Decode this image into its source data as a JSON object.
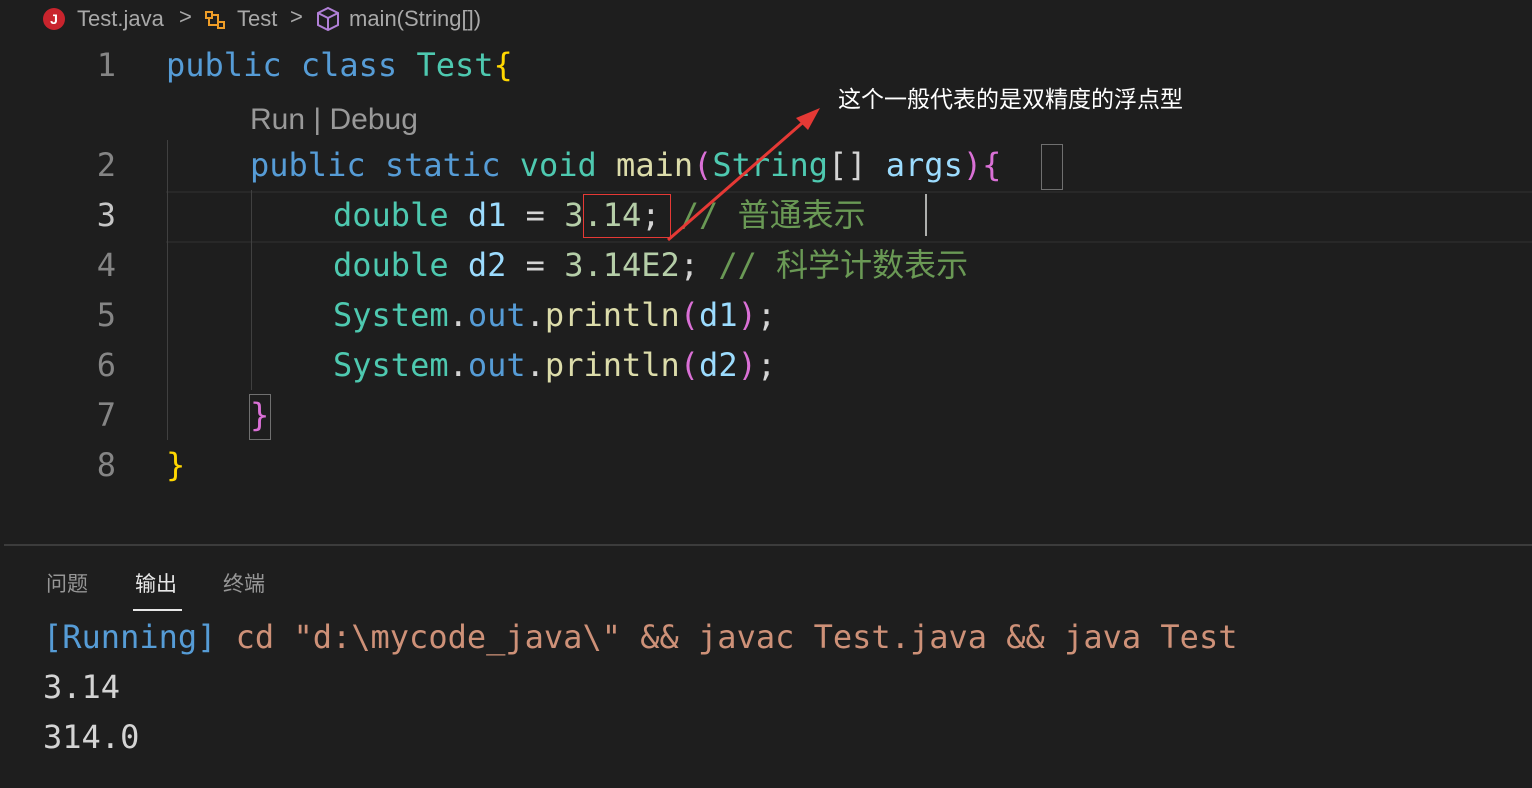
{
  "breadcrumb": {
    "file_icon_letter": "J",
    "file": "Test.java",
    "class": "Test",
    "method": "main(String[])",
    "separator": ">"
  },
  "editor": {
    "line_numbers": [
      "1",
      "2",
      "3",
      "4",
      "5",
      "6",
      "7",
      "8"
    ],
    "codelens": "Run | Debug",
    "lines": {
      "l1": {
        "kw1": "public",
        "kw2": "class",
        "name": "Test",
        "brace": "{"
      },
      "l2": {
        "kw1": "public",
        "kw2": "static",
        "kw3": "void",
        "fn": "main",
        "open": "(",
        "type": "String",
        "arr": "[]",
        "arg": "args",
        "close": ")",
        "brace": "{"
      },
      "l3": {
        "type": "double",
        "var": "d1",
        "eq": "=",
        "num": "3.14",
        "semi": ";",
        "comment": "// 普通表示"
      },
      "l4": {
        "type": "double",
        "var": "d2",
        "eq": "=",
        "num": "3.14E2",
        "semi": ";",
        "comment": "// 科学计数表示"
      },
      "l5": {
        "cls": "System",
        "dot1": ".",
        "field": "out",
        "dot2": ".",
        "fn": "println",
        "open": "(",
        "arg": "d1",
        "close": ")",
        "semi": ";"
      },
      "l6": {
        "cls": "System",
        "dot1": ".",
        "field": "out",
        "dot2": ".",
        "fn": "println",
        "open": "(",
        "arg": "d2",
        "close": ")",
        "semi": ";"
      },
      "l7": {
        "brace": "}"
      },
      "l8": {
        "brace": "}"
      }
    }
  },
  "annotation": {
    "text": "这个一般代表的是双精度的浮点型",
    "arrow_color": "#e53935"
  },
  "panel": {
    "tabs": [
      "问题",
      "输出",
      "终端"
    ],
    "active_tab": "输出",
    "output": {
      "running": "[Running]",
      "command": "cd \"d:\\mycode_java\\\" && javac Test.java && java Test",
      "result1": "3.14",
      "result2": "314.0"
    }
  },
  "colors": {
    "background": "#1e1e1e",
    "keyword": "#569cd6",
    "type": "#4ec9b0",
    "function": "#dcdcaa",
    "variable": "#9cdcfe",
    "number": "#b5cea8",
    "comment": "#6a9955",
    "string": "#ce9178"
  }
}
